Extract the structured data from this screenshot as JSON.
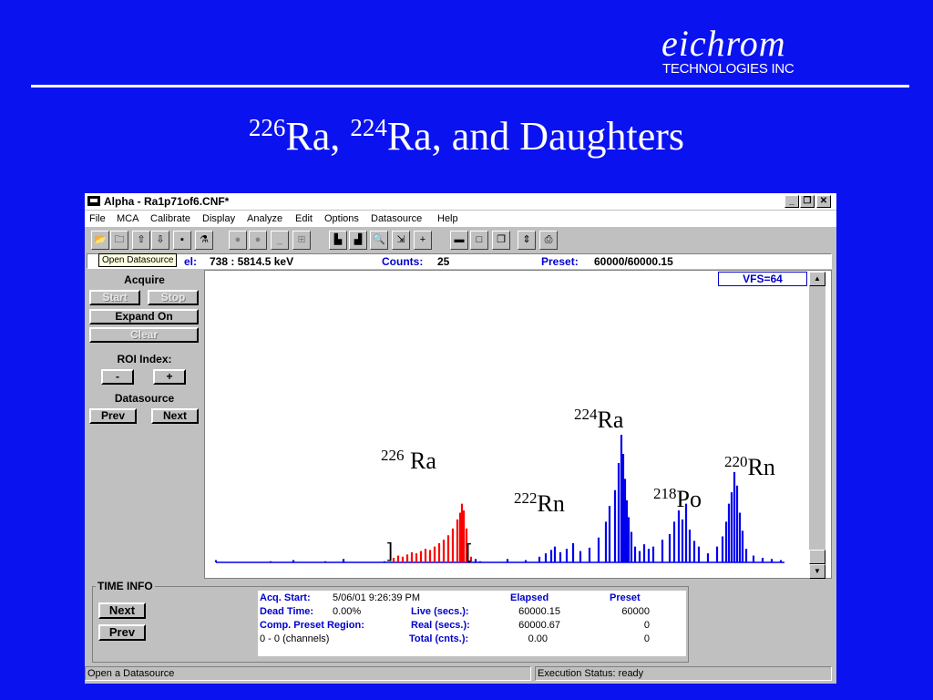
{
  "logo": {
    "word": "eichrom",
    "sub": "TECHNOLOGIES INC"
  },
  "slide_title": {
    "iso1": "226",
    "el1": "Ra, ",
    "iso2": "224",
    "el2": "Ra, and Daughters"
  },
  "window": {
    "title": "Alpha - Ra1p71of6.CNF*",
    "controls": {
      "minimize": "_",
      "restore": "❐",
      "close": "✕"
    }
  },
  "menu": [
    "File",
    "MCA",
    "Calibrate",
    "Display",
    "Analyze",
    "Edit",
    "Options",
    "Datasource",
    "Help"
  ],
  "toolbar_icons": [
    "open-folder-icon",
    "open-datasource-icon",
    "arrow-up-icon",
    "arrow-down-icon",
    "save-icon",
    "flask-icon",
    "record-icon",
    "record-icon",
    "blank-icon",
    "stack-icon",
    "bar-chart-icon",
    "log-chart-icon",
    "zoom-icon",
    "roi-icon",
    "plus-icon",
    "minimize-window-icon",
    "restore-window-icon",
    "cascade-icon",
    "fit-icon",
    "print-icon"
  ],
  "tooltip": "Open Datasource",
  "info_bar": {
    "channel_label": "el:",
    "channel_value": "738   :  5814.5 keV",
    "counts_label": "Counts:",
    "counts_value": "25",
    "preset_label": "Preset:",
    "preset_value": "60000/60000.15"
  },
  "left_panel": {
    "acquire_title": "Acquire",
    "start": "Start",
    "stop": "Stop",
    "expand_on": "Expand On",
    "clear": "Clear",
    "roi_title": "ROI Index:",
    "roi_minus": "-",
    "roi_plus": "+",
    "datasource_title": "Datasource",
    "prev": "Prev",
    "next": "Next"
  },
  "plot": {
    "vfs": "VFS=64",
    "bracket_left": "]",
    "bracket_right": "[",
    "labels": [
      {
        "iso": "226",
        "el": " Ra"
      },
      {
        "iso": "222",
        "el": "Rn"
      },
      {
        "iso": "224",
        "el": "Ra"
      },
      {
        "iso": "218",
        "el": "Po"
      },
      {
        "iso": "220",
        "el": "Rn"
      }
    ]
  },
  "scroll": {
    "up": "▲",
    "down": "▼"
  },
  "chart_data": {
    "type": "bar",
    "x": [
      0,
      60,
      85,
      120,
      140,
      185,
      195,
      200,
      205,
      210,
      215,
      220,
      225,
      230,
      235,
      240,
      245,
      250,
      255,
      260,
      265,
      268,
      270,
      272,
      275,
      280,
      285,
      290,
      320,
      340,
      355,
      362,
      368,
      372,
      378,
      385,
      392,
      400,
      410,
      420,
      428,
      432,
      438,
      442,
      445,
      447,
      449,
      451,
      453,
      456,
      460,
      465,
      470,
      475,
      480,
      490,
      498,
      503,
      508,
      512,
      516,
      520,
      525,
      530,
      540,
      550,
      556,
      560,
      563,
      566,
      569,
      572,
      575,
      578,
      582,
      590,
      600,
      610,
      620
    ],
    "values": [
      2,
      1,
      2,
      1,
      3,
      1,
      4,
      6,
      5,
      7,
      9,
      8,
      10,
      12,
      11,
      14,
      17,
      20,
      24,
      30,
      38,
      44,
      52,
      46,
      30,
      5,
      3,
      1,
      3,
      2,
      5,
      8,
      11,
      14,
      9,
      12,
      17,
      10,
      13,
      22,
      36,
      50,
      64,
      88,
      113,
      96,
      74,
      55,
      40,
      27,
      14,
      10,
      16,
      12,
      14,
      20,
      25,
      36,
      46,
      38,
      52,
      29,
      19,
      14,
      8,
      14,
      23,
      36,
      52,
      62,
      80,
      68,
      44,
      28,
      12,
      6,
      4,
      3,
      2
    ],
    "roi_channels": [
      195,
      280
    ],
    "xlabel": "",
    "ylabel": "",
    "ylim": [
      0,
      130
    ]
  },
  "time_info": {
    "legend": "TIME INFO",
    "next": "Next",
    "prev": "Prev",
    "acq_start_label": "Acq. Start:",
    "acq_start_value": "5/06/01   9:26:39 PM",
    "dead_time_label": "Dead Time:",
    "dead_time_value": "0.00%",
    "comp_preset_label": "Comp. Preset Region:",
    "range_value": "0 - 0 (channels)",
    "elapsed_header": "Elapsed",
    "preset_header": "Preset",
    "live_label": "Live (secs.):",
    "real_label": "Real (secs.):",
    "total_label": "Total (cnts.):",
    "live_elapsed": "60000.15",
    "live_preset": "60000",
    "real_elapsed": "60000.67",
    "real_preset": "0",
    "total_elapsed": "0.00",
    "total_preset": "0"
  },
  "status_bar": {
    "left": "Open a Datasource",
    "right": "Execution Status: ready"
  },
  "colors": {
    "slide_bg": "#0a12f0",
    "roi_red": "#ff0000",
    "spectrum_blue": "#0000ee",
    "label_blue": "#0000cc"
  }
}
